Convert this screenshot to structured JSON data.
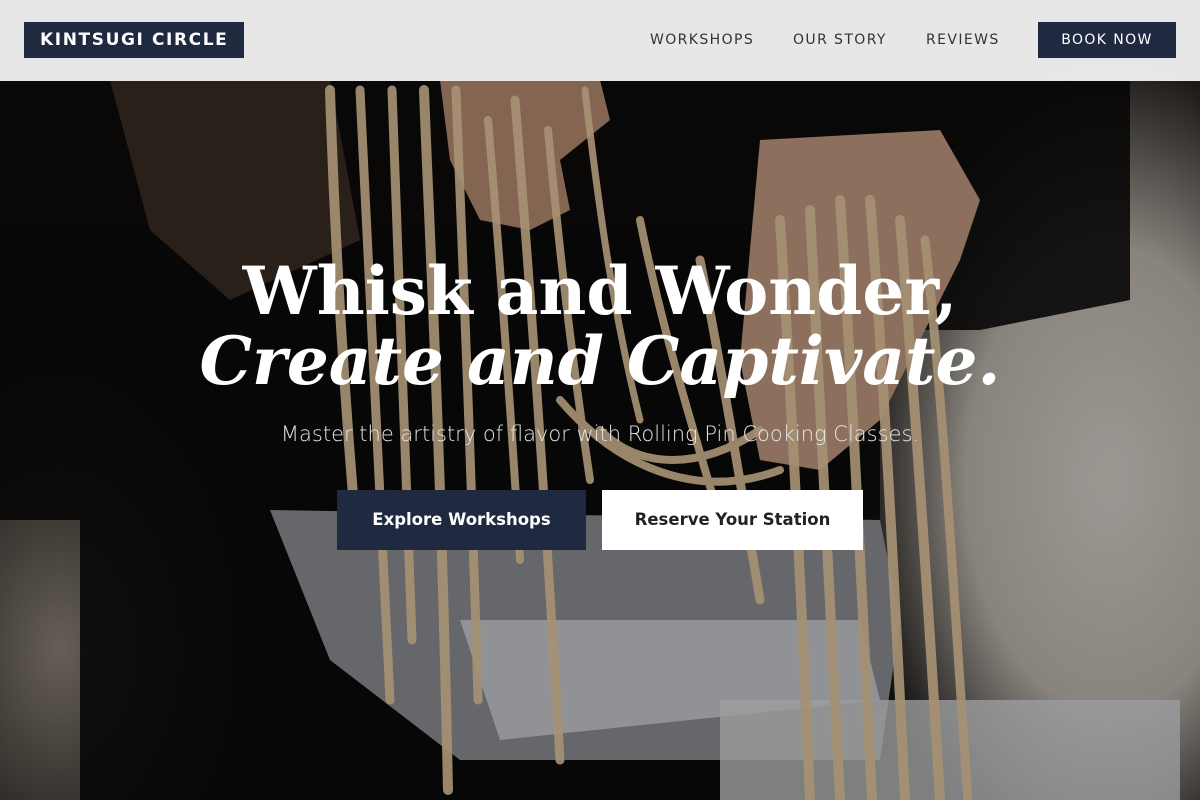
{
  "header": {
    "logo": "KINTSUGI CIRCLE",
    "nav": [
      "WORKSHOPS",
      "OUR STORY",
      "REVIEWS"
    ],
    "cta": "BOOK NOW"
  },
  "hero": {
    "headline_line1": "Whisk and Wonder,",
    "headline_line2": "Create and Captivate.",
    "subtitle": "Master the artistry of flavor with Rolling Pin Cooking Classes.",
    "primary_button": "Explore Workshops",
    "secondary_button": "Reserve Your Station",
    "background_image": "hands-holding-fresh-pasta-over-pasta-machine"
  },
  "colors": {
    "brand_navy": "#1f2940",
    "header_bg": "#eeeeee",
    "white": "#ffffff"
  }
}
